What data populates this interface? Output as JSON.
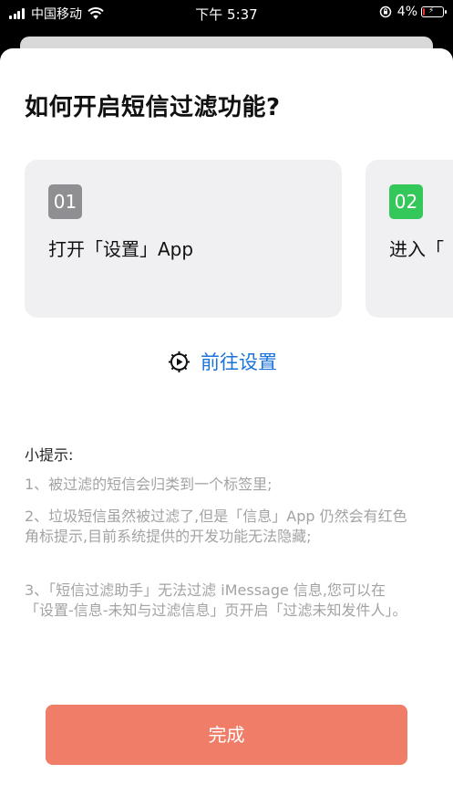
{
  "status_bar": {
    "carrier": "中国移动",
    "time": "下午 5:37",
    "battery_percent": "4%",
    "battery_level": 0.04,
    "icons": [
      "signal-icon",
      "wifi-icon",
      "orientation-lock-icon",
      "battery-charging-icon"
    ]
  },
  "sheet": {
    "title": "如何开启短信过滤功能?",
    "steps": [
      {
        "number": "01",
        "text": "打开「设置」App",
        "color": "#8e8e93"
      },
      {
        "number": "02",
        "text": "进入「",
        "color": "#34c759"
      }
    ],
    "goto_settings": {
      "label": "前往设置",
      "icon": "settings-gear-icon",
      "color": "#1a73d8"
    },
    "tips": {
      "heading": "小提示:",
      "items": [
        "1、被过滤的短信会归类到一个标签里;",
        "2、垃圾短信虽然被过滤了,但是「信息」App 仍然会有红色角标提示,目前系统提供的开发功能无法隐藏;",
        "3、「短信过滤助手」无法过滤 iMessage 信息,您可以在「设置-信息-未知与过滤信息」页开启「过滤未知发件人」。"
      ]
    },
    "done_button": {
      "label": "完成",
      "color": "#ef7d67"
    }
  }
}
